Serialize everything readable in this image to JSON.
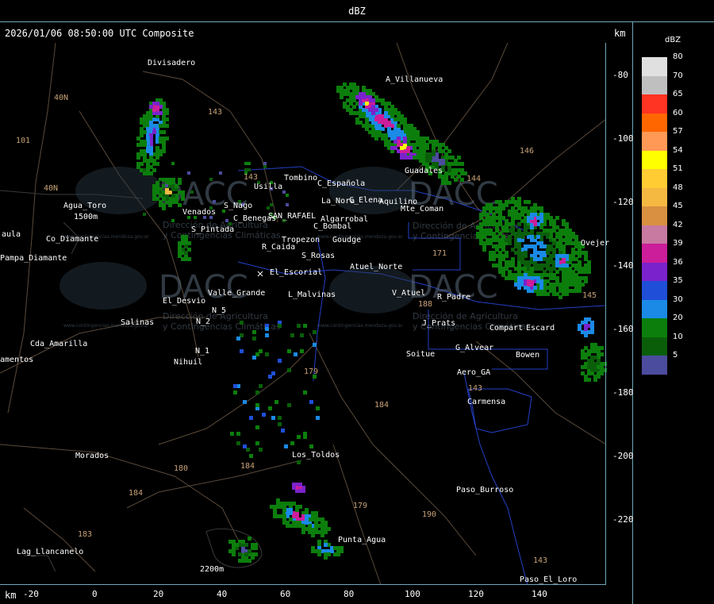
{
  "title": "dBZ",
  "header": "2026/01/06 08:50:00 UTC Composite",
  "axis_unit": "km",
  "legend": {
    "title": "dBZ",
    "levels": [
      {
        "label": "80",
        "color": "#e0e0e0"
      },
      {
        "label": "70",
        "color": "#bfbfbf"
      },
      {
        "label": "65",
        "color": "#ff3322"
      },
      {
        "label": "60",
        "color": "#ff6600"
      },
      {
        "label": "57",
        "color": "#ff9955"
      },
      {
        "label": "54",
        "color": "#ffff00"
      },
      {
        "label": "51",
        "color": "#ffcc33"
      },
      {
        "label": "48",
        "color": "#f5b942"
      },
      {
        "label": "45",
        "color": "#d99040"
      },
      {
        "label": "42",
        "color": "#c87aa0"
      },
      {
        "label": "39",
        "color": "#cc1d9a"
      },
      {
        "label": "36",
        "color": "#7a22cc"
      },
      {
        "label": "35",
        "color": "#1f4fd8"
      },
      {
        "label": "30",
        "color": "#1a8ae6"
      },
      {
        "label": "20",
        "color": "#0c7e0c"
      },
      {
        "label": "10",
        "color": "#0a5e0a"
      },
      {
        "label": "5",
        "color": "#4c4c9e"
      }
    ]
  },
  "y_ticks": [
    "-80",
    "-100",
    "-120",
    "-140",
    "-160",
    "-180",
    "-200",
    "-220"
  ],
  "x_ticks": [
    "-20",
    "0",
    "20",
    "40",
    "60",
    "80",
    "100",
    "120",
    "140"
  ],
  "places": [
    "Divisadero",
    "A_Villanueva",
    "Agua_Toro",
    "1500m",
    "Pampa_Diamante",
    "Co_Diamante",
    "aula",
    "Usilla",
    "Tombino",
    "C_Española",
    "La_Nora",
    "C_Elena",
    "Aquilino",
    "Mte_Coman",
    "S_Nago",
    "Venados",
    "C_Benegas",
    "SAN_RAFAEL",
    "Algarrobal",
    "C_Bombal",
    "S_Pintada",
    "Tropezon",
    "Goudge",
    "R_Caida",
    "S_Rosas",
    "El_Escorial",
    "Atuel_Norte",
    "Valle_Grande",
    "El_Desvio",
    "L_Malvinas",
    "V_Atuel",
    "R_Padre",
    "Salinas",
    "N_2",
    "N_5",
    "J_Prats",
    "Compart",
    "Escard",
    "Cda_Amarilla",
    "amentos",
    "N_1",
    "Nihuil",
    "Soitue",
    "G_Alvear",
    "Bowen",
    "Aero_GA",
    "Carmensa",
    "Morados",
    "Los_Toldos",
    "Paso_Burroso",
    "Punta_Agua",
    "Lag_Llancanelo",
    "2200m",
    "Paso_El_Loro",
    "Guadales",
    "Ovejer"
  ],
  "routes": [
    "40N",
    "101",
    "40N",
    "143",
    "143",
    "146",
    "144",
    "171",
    "179",
    "184",
    "180",
    "184",
    "184",
    "183",
    "179",
    "190",
    "143",
    "143",
    "145",
    "188"
  ],
  "watermark": {
    "brand": "DACC",
    "line1": "Dirección de Agricultura",
    "line2": "y Contingencias Climáticas",
    "url": "www.contingencias.mendoza.gov.ar"
  },
  "icons": [
    "colorbar",
    "radar-site-marker"
  ]
}
